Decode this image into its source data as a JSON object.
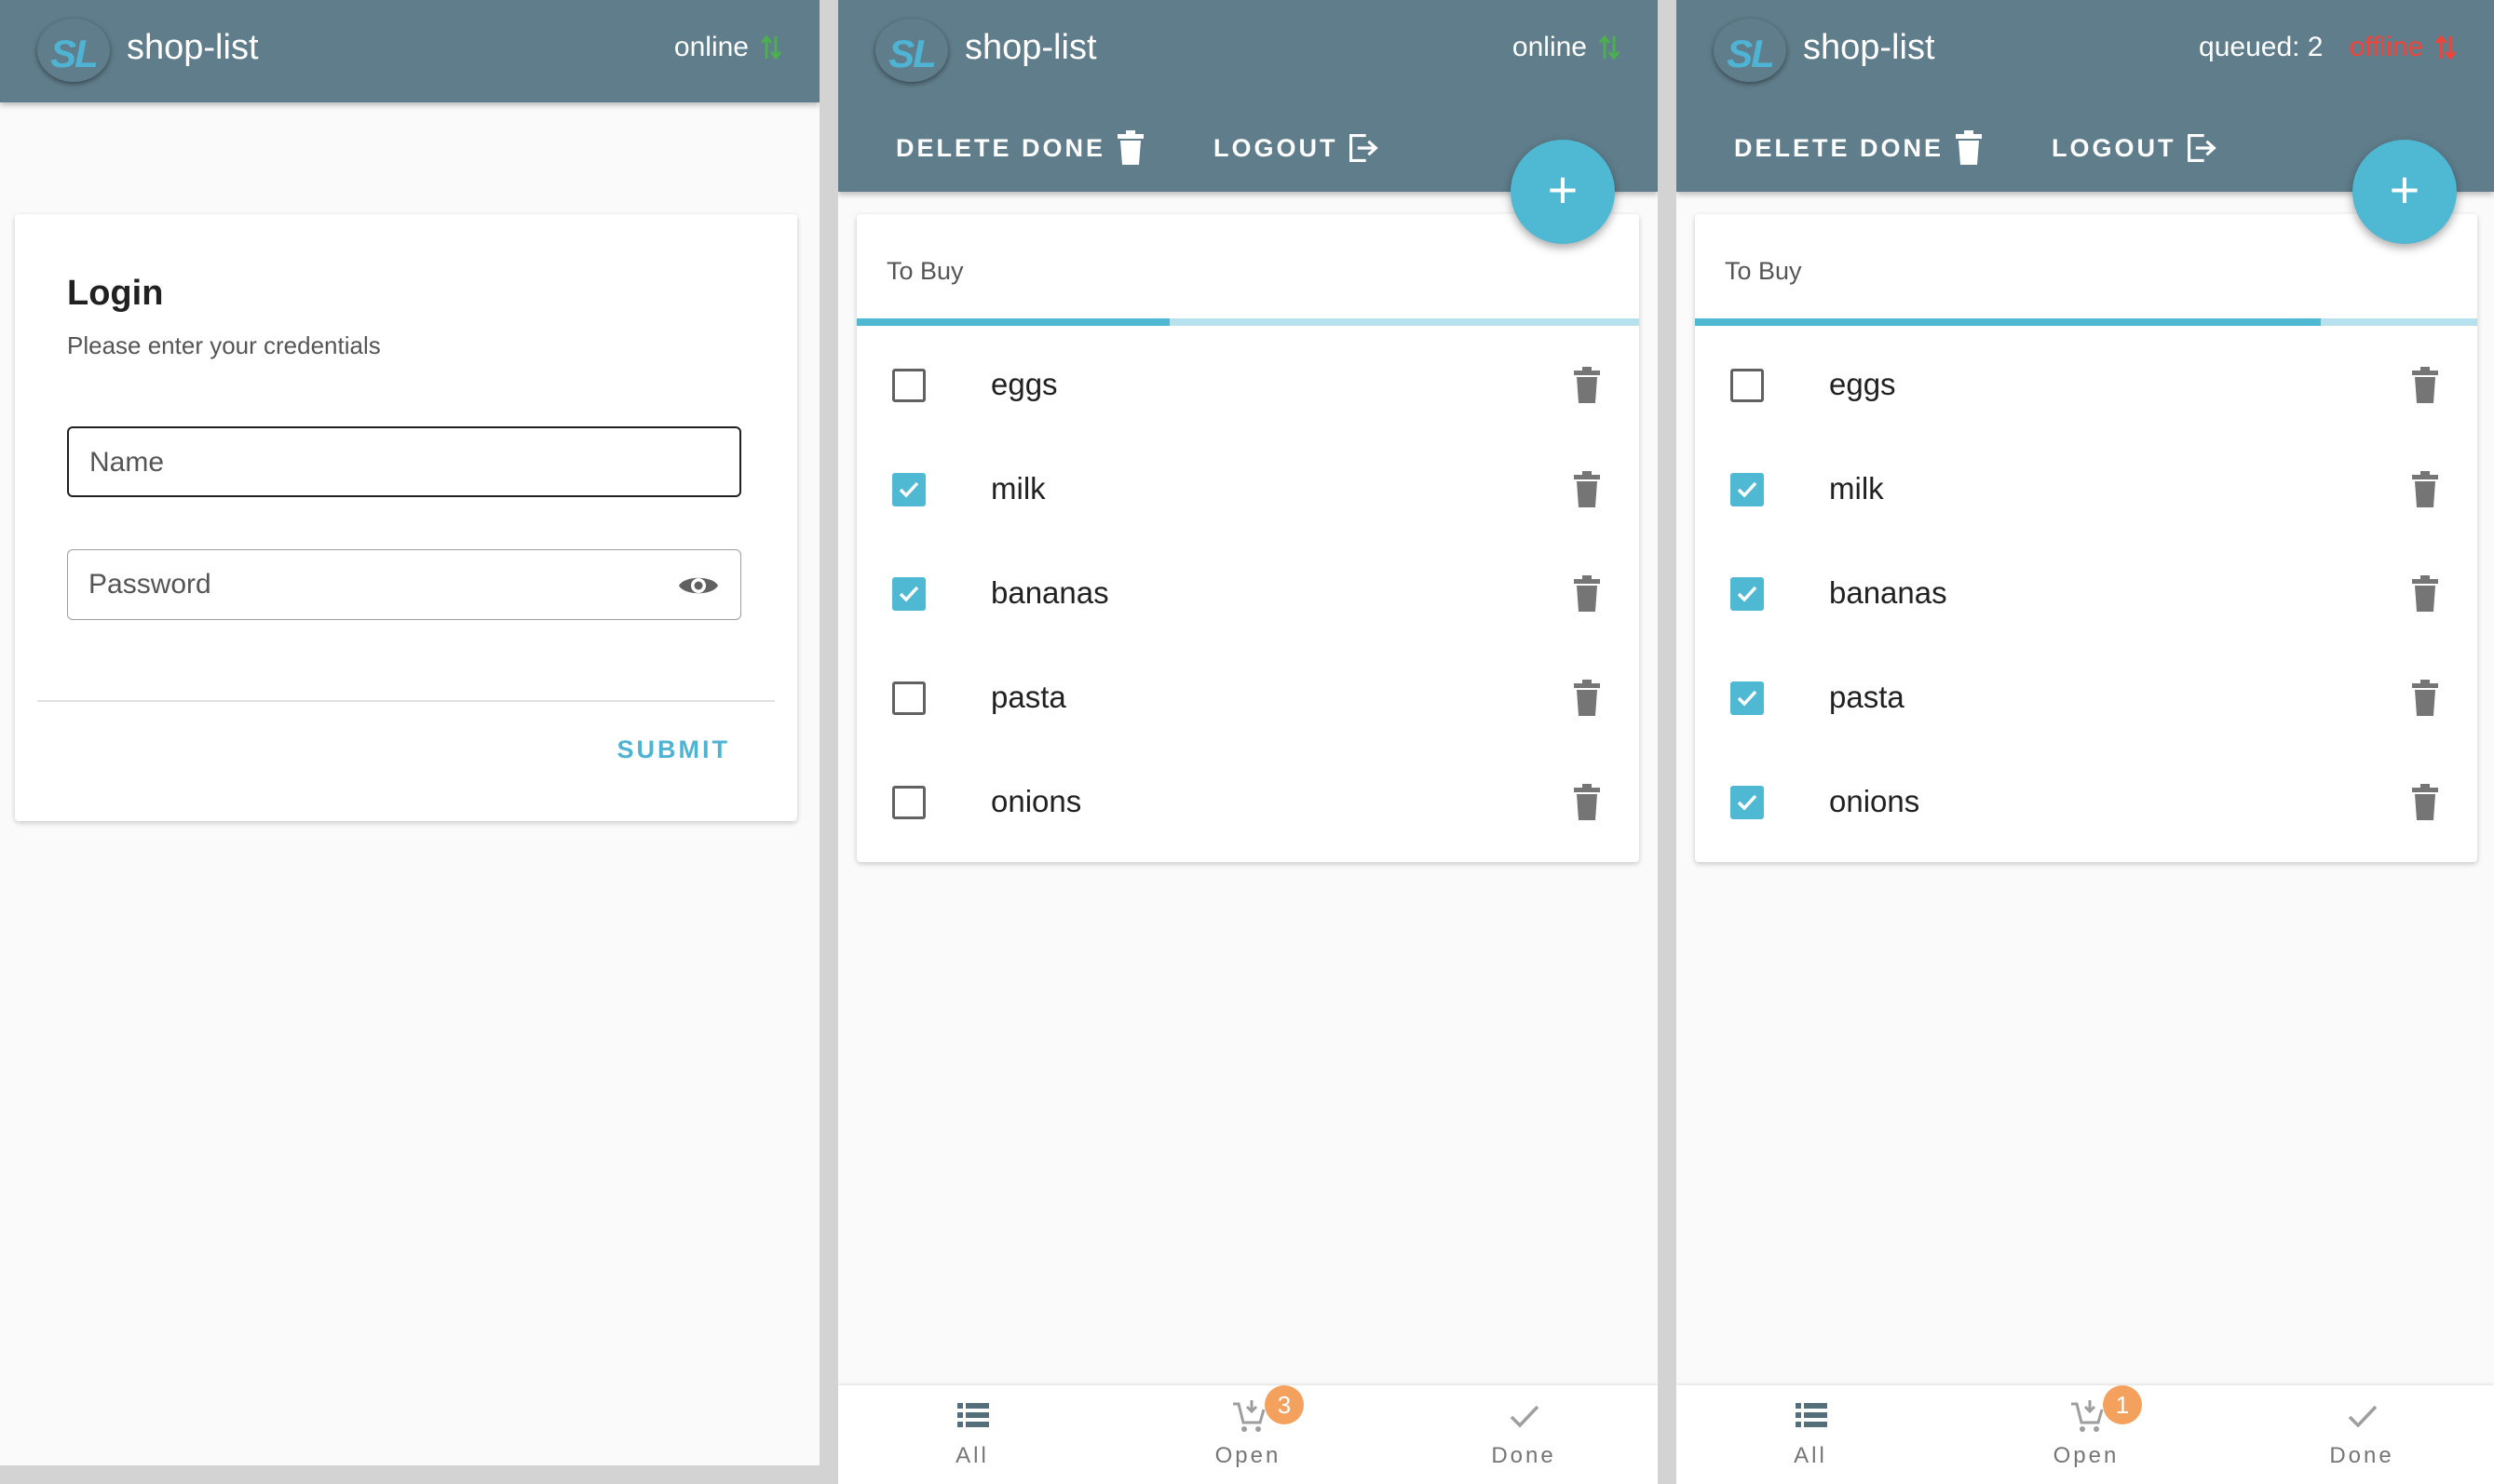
{
  "app": {
    "logo_text": "SL",
    "title": "shop-list"
  },
  "colors": {
    "appbar": "#607d8b",
    "accent": "#4fb8d2",
    "online_arrows": "#4caf50",
    "offline": "#f44336",
    "badge": "#f5a15e"
  },
  "screens": {
    "login": {
      "status": "online",
      "card": {
        "title": "Login",
        "subtitle": "Please enter your credentials",
        "name_placeholder": "Name",
        "password_placeholder": "Password",
        "submit_label": "SUBMIT"
      }
    },
    "online_list": {
      "status": "online",
      "toolbar": {
        "delete_done": "DELETE DONE",
        "logout": "LOGOUT"
      },
      "fab": "+",
      "tab_label": "To Buy",
      "progress_fraction": 0.4,
      "items": [
        {
          "label": "eggs",
          "checked": false
        },
        {
          "label": "milk",
          "checked": true
        },
        {
          "label": "bananas",
          "checked": true
        },
        {
          "label": "pasta",
          "checked": false
        },
        {
          "label": "onions",
          "checked": false
        }
      ],
      "nav": {
        "all": "All",
        "open": "Open",
        "done": "Done",
        "open_badge": "3"
      }
    },
    "offline_list": {
      "queued": "queued: 2",
      "status": "offline",
      "toolbar": {
        "delete_done": "DELETE DONE",
        "logout": "LOGOUT"
      },
      "fab": "+",
      "tab_label": "To Buy",
      "progress_fraction": 0.8,
      "items": [
        {
          "label": "eggs",
          "checked": false
        },
        {
          "label": "milk",
          "checked": true
        },
        {
          "label": "bananas",
          "checked": true
        },
        {
          "label": "pasta",
          "checked": true
        },
        {
          "label": "onions",
          "checked": true
        }
      ],
      "nav": {
        "all": "All",
        "open": "Open",
        "done": "Done",
        "open_badge": "1"
      }
    }
  }
}
